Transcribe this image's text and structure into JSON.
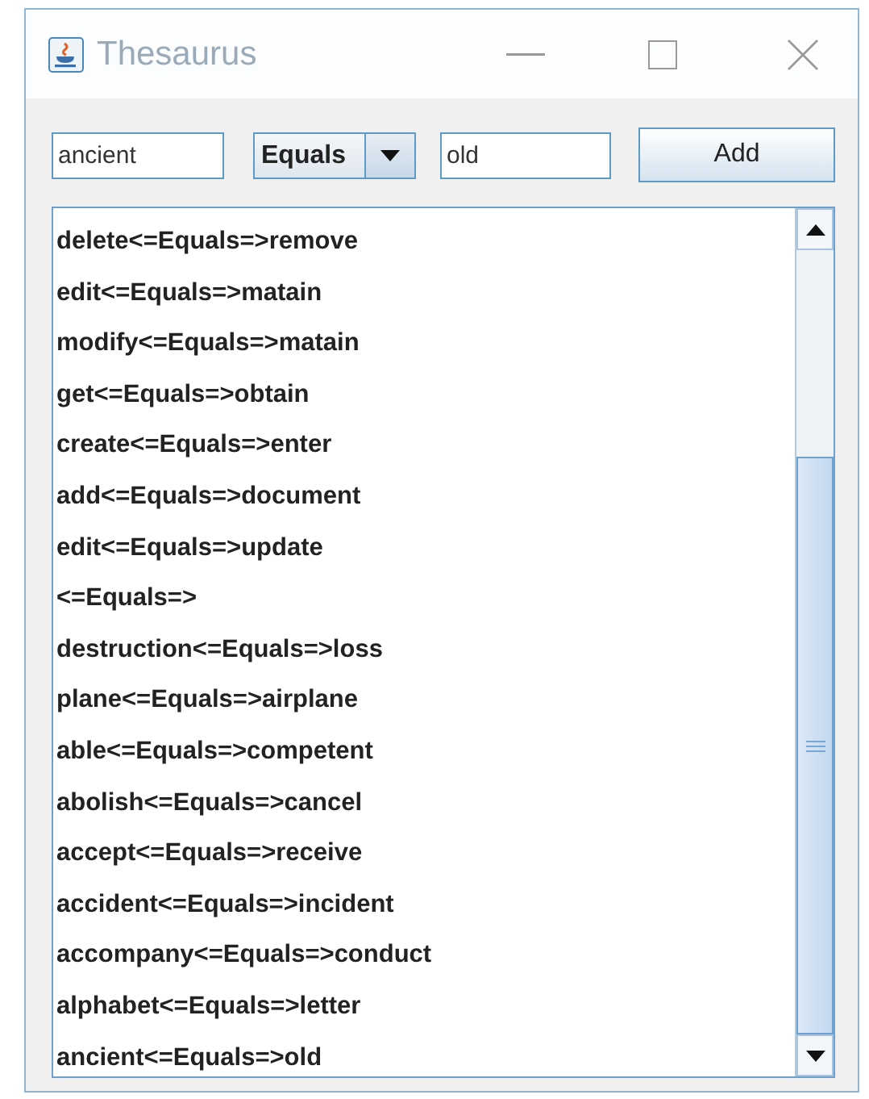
{
  "window": {
    "title": "Thesaurus"
  },
  "form": {
    "word": "ancient",
    "relation": "Equals",
    "synonym": "old",
    "add_button": "Add"
  },
  "entries": [
    "delete<=Equals=>remove",
    "edit<=Equals=>matain",
    "modify<=Equals=>matain",
    "get<=Equals=>obtain",
    "create<=Equals=>enter",
    "add<=Equals=>document",
    "edit<=Equals=>update",
    "<=Equals=>",
    "destruction<=Equals=>loss",
    "plane<=Equals=>airplane",
    "able<=Equals=>competent",
    "abolish<=Equals=>cancel",
    "accept<=Equals=>receive",
    "accident<=Equals=>incident",
    "accompany<=Equals=>conduct",
    "alphabet<=Equals=>letter",
    "ancient<=Equals=>old"
  ]
}
